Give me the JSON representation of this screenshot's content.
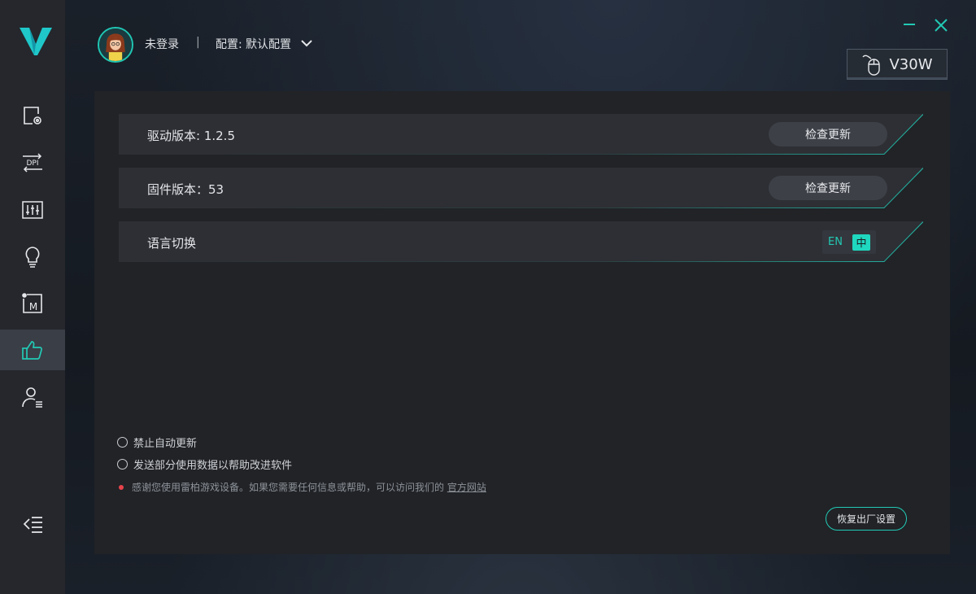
{
  "app": {
    "accent_color": "#22c9b4"
  },
  "sidebar": {
    "items": [
      {
        "name": "settings-screen",
        "icon": "screen-gear-icon"
      },
      {
        "name": "dpi",
        "icon": "dpi-icon",
        "icon_text": "DPI"
      },
      {
        "name": "performance",
        "icon": "sliders-icon"
      },
      {
        "name": "lighting",
        "icon": "lightbulb-icon"
      },
      {
        "name": "macro",
        "icon": "macro-icon",
        "icon_text": "M"
      },
      {
        "name": "support",
        "icon": "thumbs-up-icon",
        "active": true
      },
      {
        "name": "account",
        "icon": "user-list-icon"
      }
    ]
  },
  "header": {
    "login_status": "未登录",
    "separator": "|",
    "config_label": "配置:",
    "config_value": "默认配置"
  },
  "device": {
    "name": "V30W"
  },
  "settings": {
    "driver": {
      "label": "驱动版本: 1.2.5",
      "button": "检查更新"
    },
    "firmware": {
      "label": "固件版本：53",
      "button": "检查更新"
    },
    "language": {
      "label": "语言切换",
      "en": "EN",
      "zh": "中",
      "selected": "中"
    }
  },
  "options": [
    {
      "label": "禁止自动更新",
      "checked": false
    },
    {
      "label": "发送部分使用数据以帮助改进软件",
      "checked": false
    }
  ],
  "notice": {
    "text": "感谢您使用雷柏游戏设备。如果您需要任何信息或帮助，可以访问我们的",
    "link": "官方网站"
  },
  "reset_button": "恢复出厂设置"
}
